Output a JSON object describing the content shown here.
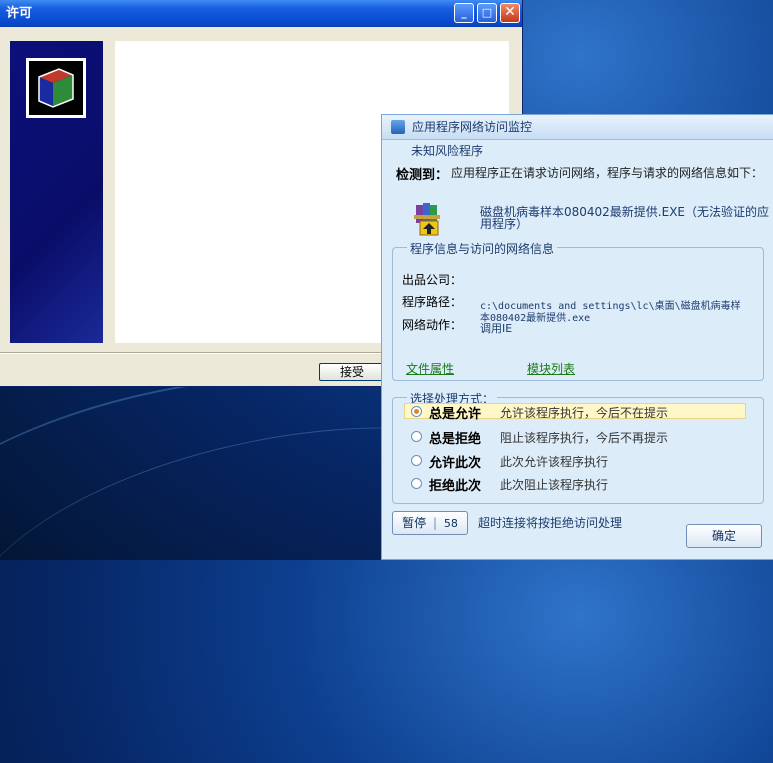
{
  "license_window": {
    "title": "许可",
    "minimize_glyph": "_",
    "maximize_glyph": "□",
    "close_glyph": "✕",
    "accept_label": "接受"
  },
  "monitor": {
    "title": "应用程序网络访问监控",
    "risk_label": "未知风险程序",
    "detected_label": "检测到：",
    "detected_text": "应用程序正在请求访问网络，程序与请求的网络信息如下：",
    "program_name_line1": "磁盘机病毒样本080402最新提供.EXE（无法验证的应",
    "program_name_line2": "用程序）",
    "info_group_title": "程序信息与访问的网络信息",
    "company_label": "出品公司：",
    "path_label": "程序路径：",
    "path_value_line1": "c:\\documents and settings\\lc\\桌面\\磁盘机病毒样",
    "path_value_line2": "本080402最新提供.exe",
    "action_label": "网络动作：",
    "action_value": "调用IE",
    "file_props_link": "文件属性",
    "module_list_link": "模块列表",
    "choice_group_title": "选择处理方式：",
    "options": [
      {
        "title": "总是允许",
        "desc": "允许该程序执行，今后不在提示",
        "selected": true
      },
      {
        "title": "总是拒绝",
        "desc": "阻止该程序执行，今后不再提示",
        "selected": false
      },
      {
        "title": "允许此次",
        "desc": "此次允许该程序执行",
        "selected": false
      },
      {
        "title": "拒绝此次",
        "desc": "此次阻止该程序执行",
        "selected": false
      }
    ],
    "pause_label": "暂停",
    "countdown": "58",
    "timeout_text": "超时连接将按拒绝访问处理",
    "ok_label": "确定"
  },
  "colors": {
    "xp_title_blue": "#0a4fd6",
    "dialog_bg": "#dcecf8",
    "link_green": "#1a7a1a",
    "highlight_yellow": "#fff7c8"
  }
}
